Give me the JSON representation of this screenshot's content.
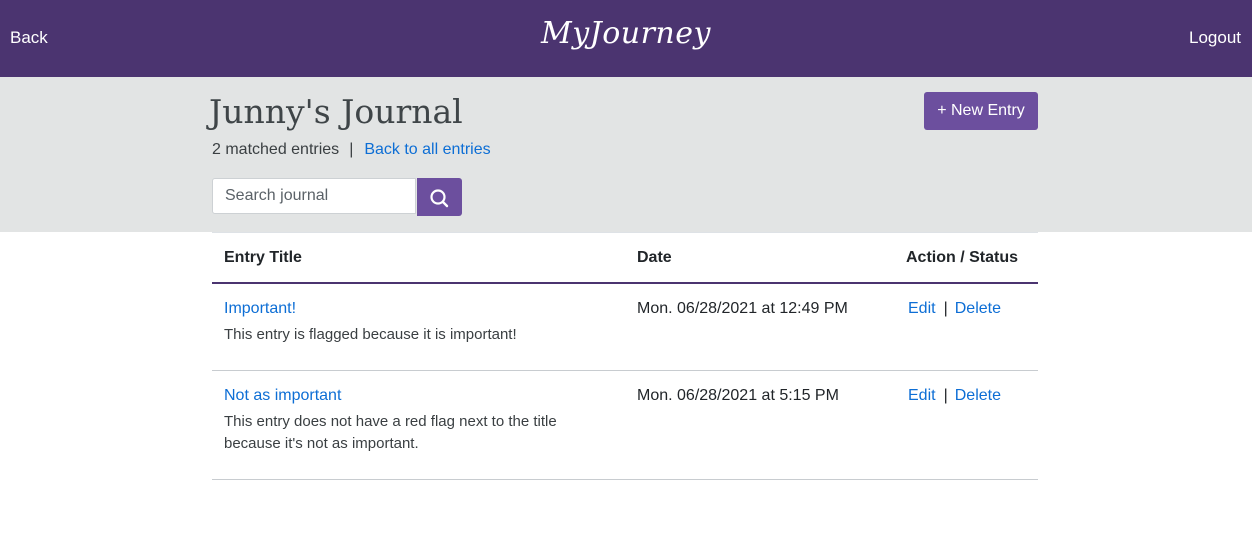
{
  "nav": {
    "back": "Back",
    "brand": "MyJourney",
    "logout": "Logout"
  },
  "journal": {
    "title": "Junny's Journal",
    "new_entry": "+ New Entry",
    "matched_text": "2 matched entries",
    "separator": "|",
    "back_to_all": "Back to all entries"
  },
  "search": {
    "placeholder": "Search journal",
    "icon": "search-icon"
  },
  "table": {
    "headers": {
      "title": "Entry Title",
      "date": "Date",
      "action": "Action / Status"
    },
    "rows": [
      {
        "title": "Important!",
        "description": "This entry is flagged because it is important!",
        "date": "Mon. 06/28/2021 at 12:49 PM",
        "edit": "Edit",
        "separator": "|",
        "delete": "Delete"
      },
      {
        "title": "Not as important",
        "description": "This entry does not have a red flag next to the title because it's not as important.",
        "date": "Mon. 06/28/2021 at 5:15 PM",
        "edit": "Edit",
        "separator": "|",
        "delete": "Delete"
      }
    ]
  },
  "colors": {
    "navbar": "#4b3470",
    "button": "#6c4f9e",
    "header_band": "#e2e4e4",
    "link": "#0d6ed5"
  }
}
